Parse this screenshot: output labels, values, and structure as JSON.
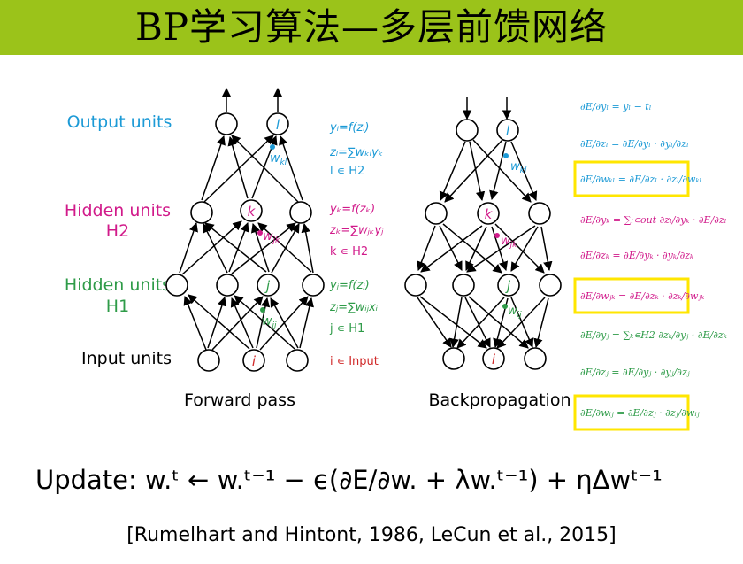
{
  "title": "BP学习算法—多层前馈网络",
  "colors": {
    "title_bg": "#9bc31a",
    "output": "#1c9ad6",
    "hidden2": "#d11a8a",
    "hidden1": "#2e9b48",
    "input": "#d12a2a",
    "box": "#ffe600"
  },
  "layers": {
    "output": "Output units",
    "hidden2_a": "Hidden units",
    "hidden2_b": "H2",
    "hidden1_a": "Hidden units",
    "hidden1_b": "H1",
    "input": "Input units"
  },
  "node_labels": {
    "l": "l",
    "k": "k",
    "j": "j",
    "i": "i"
  },
  "weight_labels": {
    "wkl": "w",
    "wkl_sub": "kl",
    "wjk": "w",
    "wjk_sub": "jk",
    "wij": "w",
    "wij_sub": "ij"
  },
  "forward_eqs": {
    "out_1": "yₗ=f(zₗ)",
    "out_2": "zₗ=∑wₖₗyₖ",
    "out_3": "l ∊ H2",
    "h2_1": "yₖ=f(zₖ)",
    "h2_2": "zₖ=∑wⱼₖyⱼ",
    "h2_3": "k ∊ H2",
    "h1_1": "yⱼ=f(zⱼ)",
    "h1_2": "zⱼ=∑wᵢⱼxᵢ",
    "h1_3": "j ∊ H1",
    "in_1": "i ∊ Input"
  },
  "captions": {
    "forward": "Forward pass",
    "backward": "Backpropagation"
  },
  "backprop_eqs": [
    "∂E/∂yₗ = yₗ − tₗ",
    "∂E/∂zₗ = ∂E/∂yₗ · ∂yₗ/∂zₗ",
    "∂E/∂wₖₗ = ∂E/∂zₗ · ∂zₗ/∂wₖₗ",
    "∂E/∂yₖ = ∑ₗ∊out ∂zₗ/∂yₖ · ∂E/∂zₗ",
    "∂E/∂zₖ = ∂E/∂yₖ · ∂yₖ/∂zₖ",
    "∂E/∂wⱼₖ = ∂E/∂zₖ · ∂zₖ/∂wⱼₖ",
    "∂E/∂yⱼ = ∑ₖ∊H2 ∂zₖ/∂yⱼ · ∂E/∂zₖ",
    "∂E/∂zⱼ = ∂E/∂yⱼ · ∂yⱼ/∂zⱼ",
    "∂E/∂wᵢⱼ = ∂E/∂zⱼ · ∂zⱼ/∂wᵢⱼ"
  ],
  "update": "Update:  w.ᵗ ← w.ᵗ⁻¹ − ϵ(∂E/∂w. + λw.ᵗ⁻¹) + ηΔwᵗ⁻¹",
  "citation": "[Rumelhart and Hintont, 1986, LeCun et al., 2015]"
}
